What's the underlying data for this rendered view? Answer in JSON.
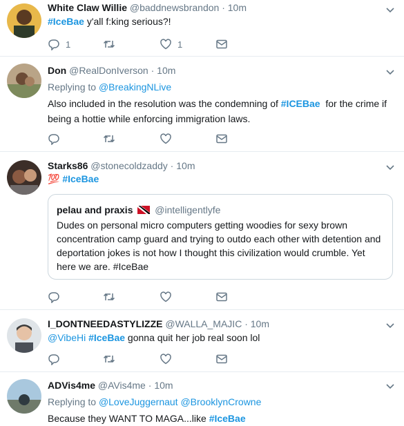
{
  "tweets": [
    {
      "name": "White Claw Willie",
      "handle": "@baddnewsbrandon",
      "time": "10m",
      "text": [
        "#IceBae",
        " y'all f​:king serious?!"
      ],
      "reply_count": "1",
      "like_count": "1"
    },
    {
      "name": "Don",
      "handle": "@RealDonIverson",
      "time": "10m",
      "replying_to_label": "Replying to ",
      "replying_to": "@BreakingNLive",
      "line1_pre": "Also included in the resolution was the condemning of ",
      "line1_tag": "#ICEBae",
      "line1_post": "  for the crime if",
      "line2": "being a hottie while enforcing immigration laws."
    },
    {
      "name": "Starks86",
      "handle": "@stonecoldzaddy",
      "time": "10m",
      "emoji": "💯",
      "tag": "#IceBae",
      "quote": {
        "name": "pelau and praxis",
        "handle": "@intelligentlyfe",
        "lines": [
          "Dudes on personal micro computers getting woodies for sexy brown",
          "concentration camp guard and trying to outdo each other with detention and",
          "deportation jokes is not how I thought this civilization would crumble. Yet",
          "here we are. #IceBae"
        ]
      }
    },
    {
      "name": "I_DONTNEEDASTYLIZZE",
      "handle": "@WALLA_MAJIC",
      "time": "10m",
      "mention": "@VibeHi",
      "tag": "#IceBae",
      "text_post": " gonna quit her job real soon lol"
    },
    {
      "name": "ADVis4me",
      "handle": "@AVis4me",
      "time": "10m",
      "replying_to_label": "Replying to ",
      "replying_to": "@LoveJuggernaut",
      "replying_to_2": "@BrooklynCrowne",
      "text_pre": "Because they WANT TO MAGA...like ",
      "tag": "#IceBae"
    }
  ],
  "separator": " · ",
  "colors": {
    "link": "#1b95e0",
    "muted": "#657786",
    "border": "#e6ecf0"
  },
  "icons": [
    "reply-icon",
    "retweet-icon",
    "like-icon",
    "dm-icon",
    "chevron-down-icon",
    "flag-icon"
  ]
}
